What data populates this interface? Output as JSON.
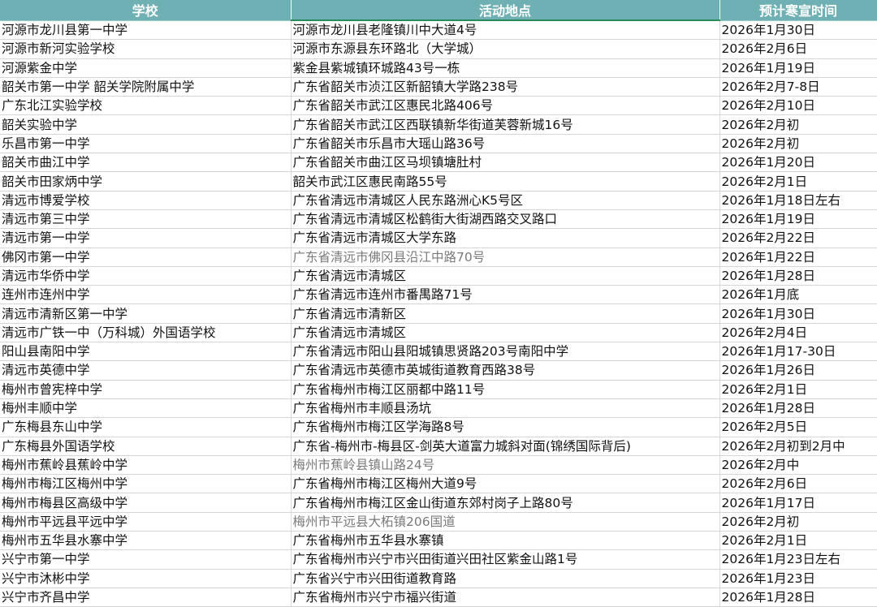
{
  "columns": [
    "学校",
    "活动地点",
    "预计寒宣时间"
  ],
  "rows": [
    {
      "school": "河源市龙川县第一中学",
      "location": "河源市龙川县老隆镇川中大道4号",
      "time": "2026年1月30日"
    },
    {
      "school": "河源市新河实验学校",
      "location": "河源市东源县东环路北（大学城）",
      "time": "2026年2月6日"
    },
    {
      "school": "河源紫金中学",
      "location": "紫金县紫城镇环城路43号一栋",
      "time": "2026年1月19日"
    },
    {
      "school": "韶关市第一中学 韶关学院附属中学",
      "location": "广东省韶关市浈江区新韶镇大学路238号",
      "time": "2026年2月7-8日"
    },
    {
      "school": "广东北江实验学校",
      "location": "广东省韶关市武江区惠民北路406号",
      "time": "2026年2月10日"
    },
    {
      "school": "韶关实验中学",
      "location": "广东省韶关市武江区西联镇新华街道芙蓉新城16号",
      "time": "2026年2月初"
    },
    {
      "school": "乐昌市第一中学",
      "location": "广东省韶关市乐昌市大瑶山路36号",
      "time": "2026年2月初"
    },
    {
      "school": "韶关市曲江中学",
      "location": "广东省韶关市曲江区马坝镇塘肚村",
      "time": "2026年1月20日"
    },
    {
      "school": "韶关市田家炳中学",
      "location": "韶关市武江区惠民南路55号",
      "time": "2026年2月1日"
    },
    {
      "school": "清远市博爱学校",
      "location": "广东省清远市清城区人民东路洲心K5号区",
      "time": "2026年1月18日左右"
    },
    {
      "school": "清远市第三中学",
      "location": "广东省清远市清城区松鹤街大街湖西路交叉路口",
      "time": "2026年1月19日"
    },
    {
      "school": "清远市第一中学",
      "location": "广东省清远市清城区大学东路",
      "time": "2026年2月22日"
    },
    {
      "school": "佛冈市第一中学",
      "location": "广东省清远市佛冈县沿江中路70号",
      "time": "2026年1月22日",
      "location_gray": true
    },
    {
      "school": "清远市华侨中学",
      "location": "广东省清远市清城区",
      "time": "2026年1月28日"
    },
    {
      "school": "连州市连州中学",
      "location": "广东省清远市连州市番禺路71号",
      "time": "2026年1月底"
    },
    {
      "school": "清远市清新区第一中学",
      "location": "广东省清远市清新区",
      "time": "2026年1月30日"
    },
    {
      "school": "清远市广铁一中（万科城）外国语学校",
      "location": "广东省清远市清城区",
      "time": "2026年2月4日"
    },
    {
      "school": "阳山县南阳中学",
      "location": "广东省清远市阳山县阳城镇思贤路203号南阳中学",
      "time": "2026年1月17-30日"
    },
    {
      "school": "清远市英德中学",
      "location": "广东省清远市英德市英城街道教育西路38号",
      "time": "2026年1月26日"
    },
    {
      "school": "梅州市曾宪梓中学",
      "location": "广东省梅州市梅江区丽都中路11号",
      "time": "2026年2月1日"
    },
    {
      "school": "梅州丰顺中学",
      "location": "广东省梅州市丰顺县汤坑",
      "time": "2026年1月28日"
    },
    {
      "school": "广东梅县东山中学",
      "location": "广东省梅州市梅江区学海路8号",
      "time": "2026年2月5日"
    },
    {
      "school": "广东梅县外国语学校",
      "location": "广东省-梅州市-梅县区-剑英大道富力城斜对面(锦绣国际背后)",
      "time": "2026年2月初到2月中"
    },
    {
      "school": "梅州市蕉岭县蕉岭中学",
      "location": "梅州市蕉岭县镇山路24号",
      "time": "2026年2月中",
      "location_gray": true
    },
    {
      "school": "梅州市梅江区梅州中学",
      "location": "广东省梅州市梅江区梅州大道9号",
      "time": "2026年2月6日"
    },
    {
      "school": "梅州市梅县区高级中学",
      "location": "广东省梅州市梅江区金山街道东郊村岗子上路80号",
      "time": "2026年1月17日"
    },
    {
      "school": "梅州市平远县平远中学",
      "location": "梅州市平远县大柘镇206国道",
      "time": "2026年2月初",
      "location_gray": true
    },
    {
      "school": "梅州市五华县水寨中学",
      "location": "广东省梅州市五华县水寨镇",
      "time": "2026年2月1日"
    },
    {
      "school": "兴宁市第一中学",
      "location": "广东省梅州市兴宁市兴田街道兴田社区紫金山路1号",
      "time": "2026年1月23日左右"
    },
    {
      "school": "兴宁市沐彬中学",
      "location": "广东省兴宁市兴田街道教育路",
      "time": "2026年1月23日"
    },
    {
      "school": "兴宁市齐昌中学",
      "location": "广东省梅州市兴宁市福兴街道",
      "time": "2026年1月28日"
    }
  ]
}
